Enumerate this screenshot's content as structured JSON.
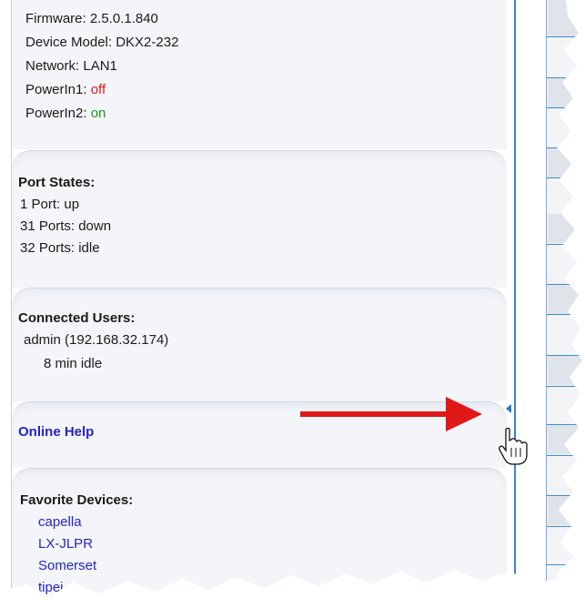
{
  "device_info": {
    "firmware": "Firmware: 2.5.0.1.840",
    "model": "Device Model: DKX2-232",
    "network": "Network: LAN1",
    "power1_label": "PowerIn1: ",
    "power1_value": "off",
    "power2_label": "PowerIn2: ",
    "power2_value": "on"
  },
  "port_states": {
    "title": "Port States:",
    "up": "1 Port: up",
    "down": "31 Ports: down",
    "idle": "32 Ports: idle"
  },
  "connected_users": {
    "title": "Connected Users:",
    "user": "admin (192.168.32.174)",
    "idle": "8 min idle"
  },
  "online_help": {
    "label": "Online Help"
  },
  "favorite_devices": {
    "title": "Favorite Devices:",
    "items": [
      "capella",
      "LX-JLPR",
      "Somerset",
      "tipei"
    ]
  },
  "colors": {
    "status_off": "#e41b1b",
    "status_on": "#1a9a1a",
    "link": "#2323c6",
    "arrow": "#e01818",
    "divider": "#3a86d4"
  },
  "icons": {
    "arrow": "red-arrow-icon",
    "cursor": "hand-cursor-icon",
    "collapse_handle": "collapse-handle-icon"
  }
}
